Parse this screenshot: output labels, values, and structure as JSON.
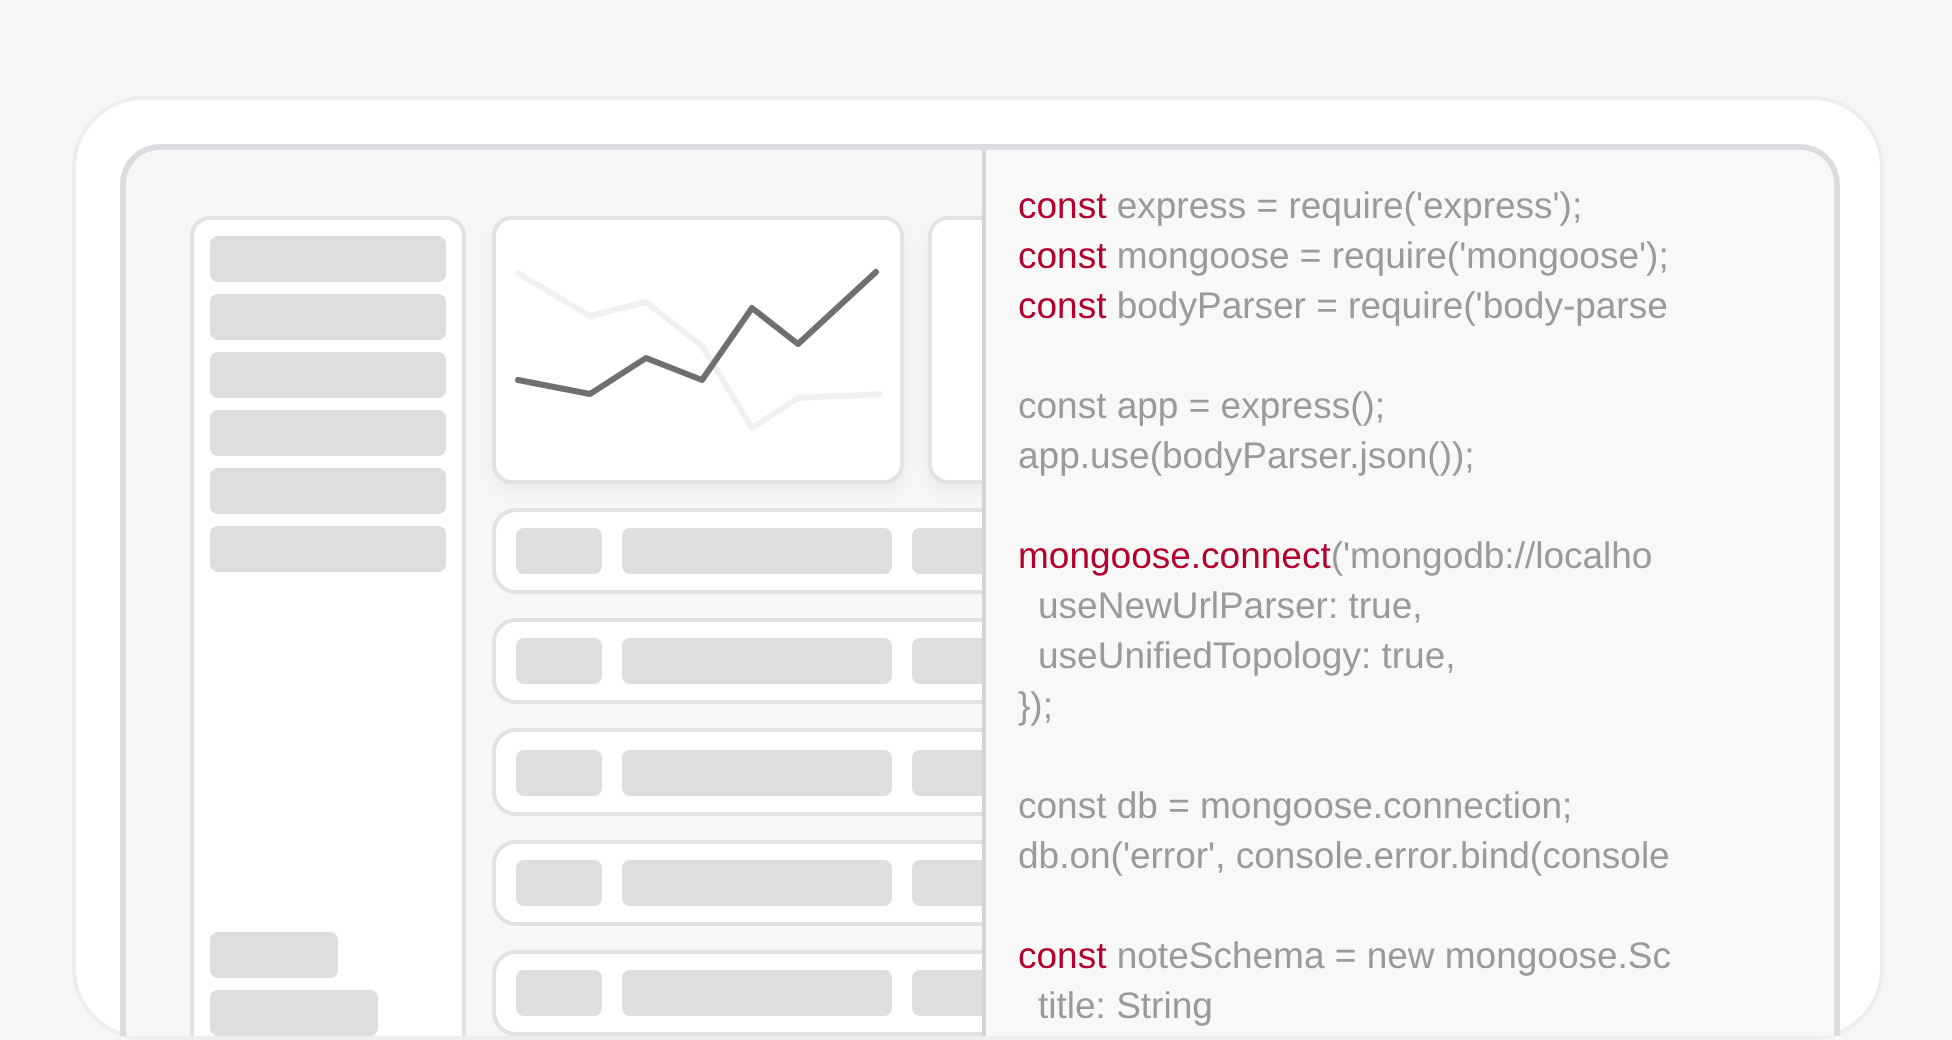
{
  "code_lines": [
    {
      "kind": "code",
      "indented": false,
      "segments": [
        {
          "kind": "keyword",
          "text": "const"
        },
        {
          "kind": "plain",
          "text": " express = require('express');"
        }
      ]
    },
    {
      "kind": "code",
      "indented": false,
      "segments": [
        {
          "kind": "keyword",
          "text": "const"
        },
        {
          "kind": "plain",
          "text": " mongoose = require('mongoose');"
        }
      ]
    },
    {
      "kind": "code",
      "indented": false,
      "segments": [
        {
          "kind": "keyword",
          "text": "const"
        },
        {
          "kind": "plain",
          "text": " bodyParser = require('body-parse"
        }
      ]
    },
    {
      "kind": "blank"
    },
    {
      "kind": "code",
      "indented": false,
      "segments": [
        {
          "kind": "plain",
          "text": "const app = express();"
        }
      ]
    },
    {
      "kind": "code",
      "indented": false,
      "segments": [
        {
          "kind": "plain",
          "text": "app.use(bodyParser.json());"
        }
      ]
    },
    {
      "kind": "blank"
    },
    {
      "kind": "code",
      "indented": false,
      "segments": [
        {
          "kind": "keyword",
          "text": "mongoose.connect"
        },
        {
          "kind": "plain",
          "text": "('mongodb://localho"
        }
      ]
    },
    {
      "kind": "code",
      "indented": true,
      "segments": [
        {
          "kind": "plain",
          "text": "useNewUrlParser: true,"
        }
      ]
    },
    {
      "kind": "code",
      "indented": true,
      "segments": [
        {
          "kind": "plain",
          "text": "useUnifiedTopology: true,"
        }
      ]
    },
    {
      "kind": "code",
      "indented": false,
      "segments": [
        {
          "kind": "plain",
          "text": "});"
        }
      ]
    },
    {
      "kind": "blank"
    },
    {
      "kind": "code",
      "indented": false,
      "segments": [
        {
          "kind": "plain",
          "text": "const db = mongoose.connection;"
        }
      ]
    },
    {
      "kind": "code",
      "indented": false,
      "segments": [
        {
          "kind": "plain",
          "text": "db.on('error', console.error.bind(console"
        }
      ]
    },
    {
      "kind": "blank"
    },
    {
      "kind": "code",
      "indented": false,
      "segments": [
        {
          "kind": "keyword",
          "text": "const"
        },
        {
          "kind": "plain",
          "text": " noteSchema = new mongoose.Sc"
        }
      ]
    },
    {
      "kind": "code",
      "indented": true,
      "segments": [
        {
          "kind": "plain",
          "text": "title: String"
        }
      ]
    }
  ]
}
